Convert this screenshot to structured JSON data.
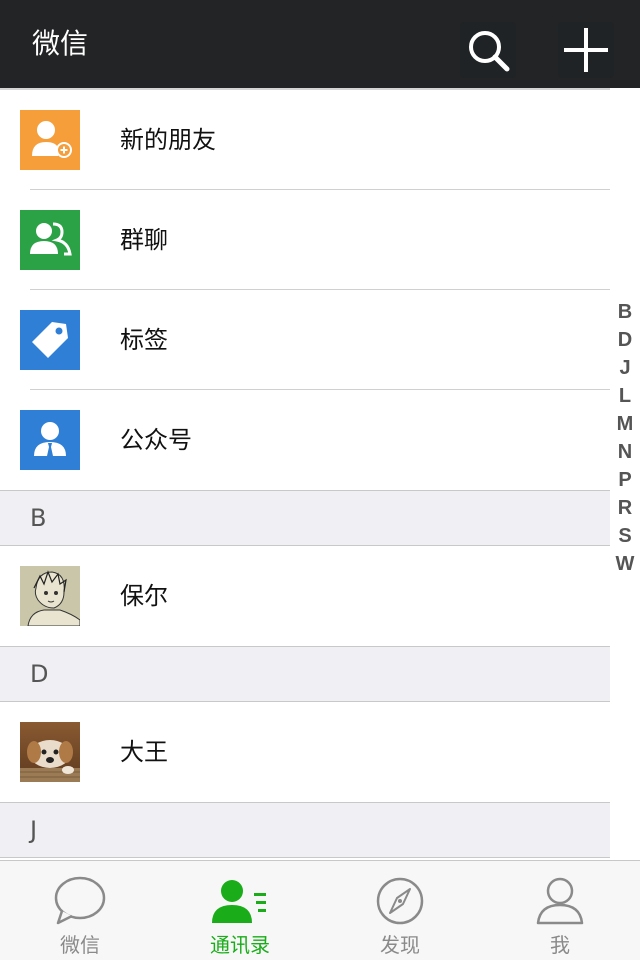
{
  "header": {
    "title": "微信"
  },
  "top_items": [
    {
      "name": "新的朋友",
      "icon": "new-friend-icon",
      "color": "#f59e3a"
    },
    {
      "name": "群聊",
      "icon": "group-chat-icon",
      "color": "#2ba245"
    },
    {
      "name": "标签",
      "icon": "tag-icon",
      "color": "#2f7fd6"
    },
    {
      "name": "公众号",
      "icon": "official-account-icon",
      "color": "#2f7fd6"
    }
  ],
  "sections": [
    {
      "letter": "B",
      "contacts": [
        {
          "name": "保尔",
          "avatar": "anime-sketch-avatar"
        }
      ]
    },
    {
      "letter": "D",
      "contacts": [
        {
          "name": "大王",
          "avatar": "puppy-photo-avatar"
        }
      ]
    },
    {
      "letter": "J",
      "contacts": []
    }
  ],
  "index_letters": [
    "B",
    "D",
    "J",
    "L",
    "M",
    "N",
    "P",
    "R",
    "S",
    "W"
  ],
  "tabs": [
    {
      "label": "微信",
      "icon": "chat-bubble-icon",
      "active": false
    },
    {
      "label": "通讯录",
      "icon": "contacts-icon",
      "active": true
    },
    {
      "label": "发现",
      "icon": "compass-icon",
      "active": false
    },
    {
      "label": "我",
      "icon": "me-person-icon",
      "active": false
    }
  ],
  "colors": {
    "header_bg": "#232425",
    "active_tab": "#1aad19",
    "inactive_tab": "#8a8a8a",
    "section_bg": "#efeff4"
  }
}
